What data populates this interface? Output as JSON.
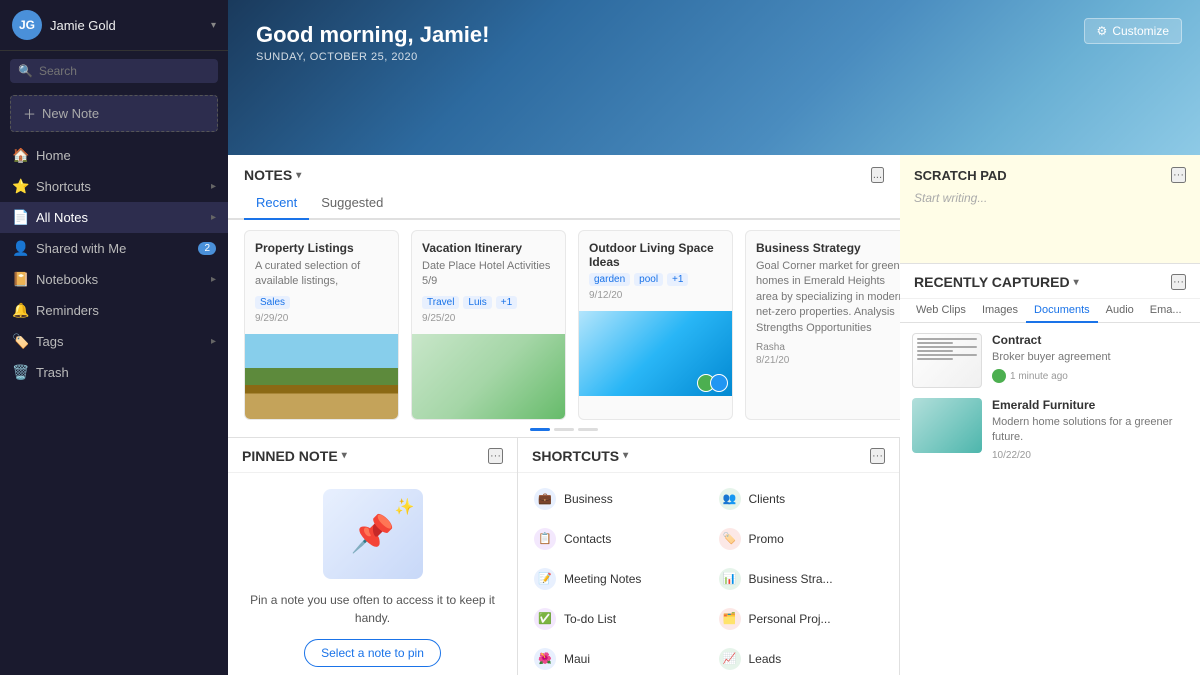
{
  "sidebar": {
    "username": "Jamie Gold",
    "avatar_initials": "JG",
    "search_placeholder": "Search",
    "new_note_label": "New Note",
    "home_label": "Home",
    "shortcuts_label": "Shortcuts",
    "all_notes_label": "All Notes",
    "shared_label": "Shared with Me",
    "shared_badge": "2",
    "notebooks_label": "Notebooks",
    "reminders_label": "Reminders",
    "tags_label": "Tags",
    "trash_label": "Trash"
  },
  "hero": {
    "greeting": "Good morning, Jamie!",
    "date": "SUNDAY, OCTOBER 25, 2020",
    "customize_label": "Customize"
  },
  "notes_section": {
    "title": "NOTES",
    "tab_recent": "Recent",
    "tab_suggested": "Suggested",
    "more_label": "...",
    "cards": [
      {
        "title": "Property Listings",
        "text": "A curated selection of available listings,",
        "tags": [
          "Sales"
        ],
        "date": "9/29/20",
        "has_image": true,
        "image_type": "house"
      },
      {
        "title": "Vacation Itinerary",
        "text": "Date Place Hotel Activities 5/9",
        "tags": [
          "Travel",
          "Luis",
          "+1"
        ],
        "date": "9/25/20",
        "has_image": true,
        "image_type": "map",
        "has_avatars": false
      },
      {
        "title": "Outdoor Living Space Ideas",
        "text": "",
        "tags": [
          "garden",
          "pool",
          "+1"
        ],
        "date": "9/12/20",
        "has_image": true,
        "image_type": "pool",
        "has_avatars": true
      },
      {
        "title": "Business Strategy",
        "text": "Goal Corner market for green homes in Emerald Heights area by specializing in modern, net-zero properties. Analysis Strengths Opportunities",
        "tags": [],
        "date": "8/21/20",
        "has_image": false,
        "author": "Rasha",
        "has_avatars": true
      }
    ]
  },
  "pinned_note": {
    "title": "PINNED NOTE",
    "desc": "Pin a note you use often to access it to keep it handy.",
    "btn_label": "Select a note to pin"
  },
  "shortcuts": {
    "title": "SHORTCUTS",
    "items": [
      {
        "label": "Business",
        "icon": "💼"
      },
      {
        "label": "Clients",
        "icon": "👥"
      },
      {
        "label": "Contacts",
        "icon": "📋"
      },
      {
        "label": "Promo",
        "icon": "🏷️"
      },
      {
        "label": "Meeting Notes",
        "icon": "📝"
      },
      {
        "label": "Business Stra...",
        "icon": "📊"
      },
      {
        "label": "To-do List",
        "icon": "✅"
      },
      {
        "label": "Personal Proj...",
        "icon": "🗂️"
      },
      {
        "label": "Maui",
        "icon": "🌺"
      },
      {
        "label": "Leads",
        "icon": "📈"
      }
    ]
  },
  "scratch_pad": {
    "title": "SCRATCH PAD",
    "placeholder": "Start writing...",
    "more_label": "..."
  },
  "recently_captured": {
    "title": "RECENTLY CAPTURED",
    "tabs": [
      "Web Clips",
      "Images",
      "Documents",
      "Audio",
      "Ema..."
    ],
    "active_tab": "Documents",
    "items": [
      {
        "title": "Contract",
        "desc": "Broker buyer agreement",
        "meta": "1 minute ago",
        "type": "document"
      },
      {
        "title": "Emerald Furniture",
        "desc": "Modern home solutions for a greener future.",
        "meta": "10/22/20",
        "type": "image"
      }
    ]
  }
}
